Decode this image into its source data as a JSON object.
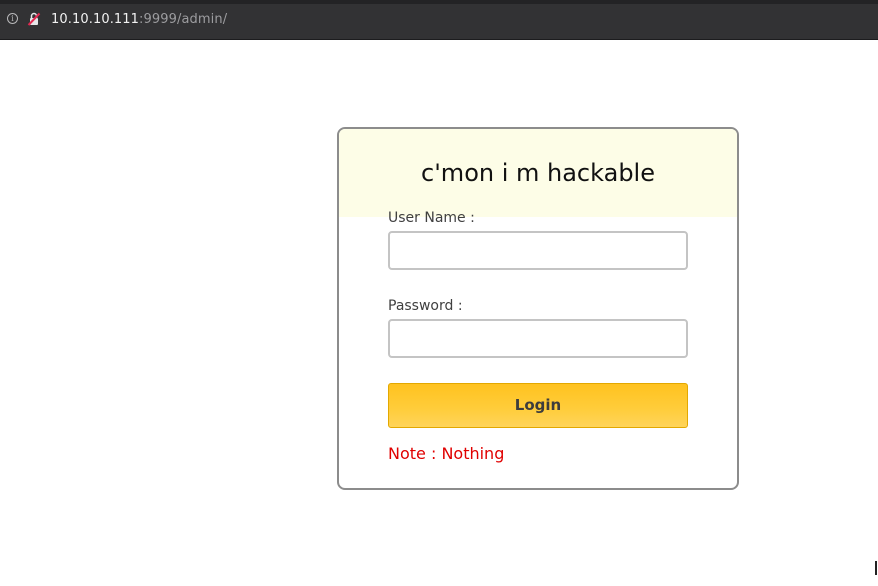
{
  "browser": {
    "url_host": "10.10.10.111",
    "url_rest": ":9999/admin/",
    "info_icon": "i"
  },
  "login": {
    "title": "c'mon i m hackable",
    "username_label": "User Name :",
    "username_value": "",
    "password_label": "Password :",
    "password_value": "",
    "login_button": "Login",
    "note": "Note : Nothing"
  },
  "colors": {
    "header_bg": "#fdfde7",
    "button": "#ffc21f",
    "note": "#e00000"
  }
}
